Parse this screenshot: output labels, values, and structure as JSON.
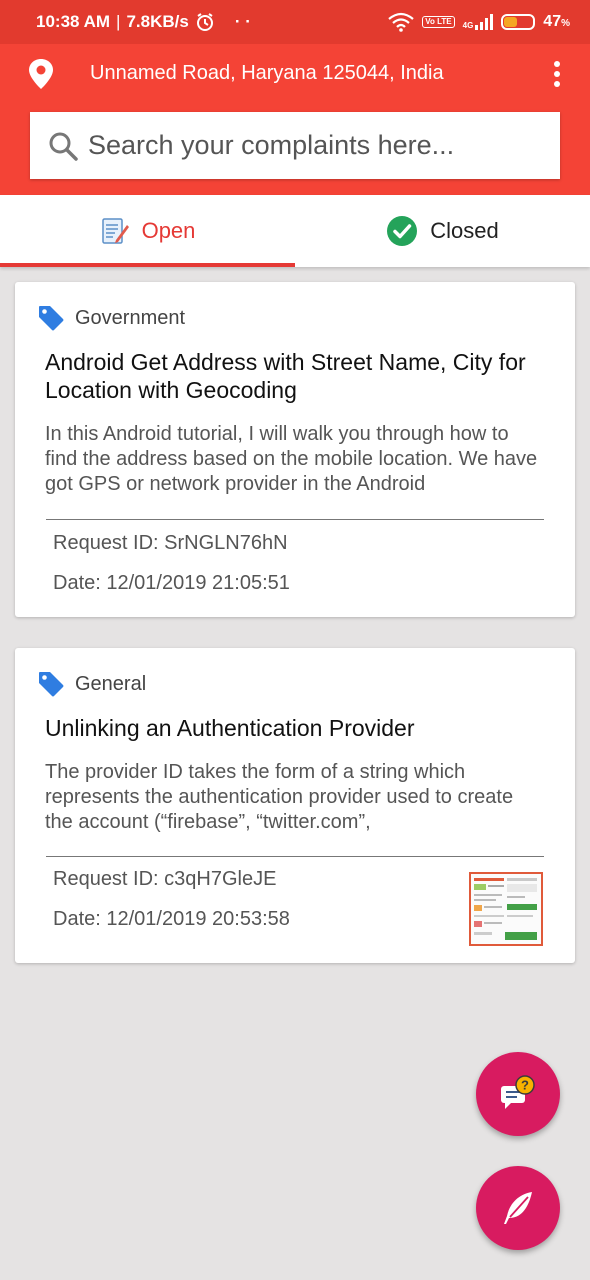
{
  "status_bar": {
    "time": "10:38 AM",
    "separator": "|",
    "speed": "7.8KB/s",
    "dots": "· ·",
    "volte": "Vo LTE",
    "network": "4G",
    "battery_percent": "47",
    "battery_unit": "%",
    "battery_level": 0.47
  },
  "header": {
    "address": "Unnamed Road, Haryana 125044, India",
    "search_placeholder": "Search your complaints here..."
  },
  "tabs": [
    {
      "label": "Open",
      "active": true
    },
    {
      "label": "Closed",
      "active": false
    }
  ],
  "complaints": [
    {
      "category": "Government",
      "title": "Android Get Address with Street Name, City for Location with Geocoding",
      "description": "In this Android tutorial, I will walk you through how to find the address based on the mobile location. We have got GPS or network provider in the Android",
      "request_id": "Request ID: SrNGLN76hN",
      "date": "Date: 12/01/2019 21:05:51"
    },
    {
      "category": "General",
      "title": "Unlinking an Authentication Provider",
      "description": "The provider ID takes the form of a string which represents the authentication provider used to create the account (“firebase”, “twitter.com”,",
      "request_id": "Request ID: c3qH7GleJE",
      "date": "Date: 12/01/2019 20:53:58"
    }
  ],
  "colors": {
    "status_bar": "#e23a2e",
    "header": "#f44336",
    "accent": "#e53935",
    "fab": "#d81b60",
    "tag": "#2f7de1",
    "check": "#24a35a"
  },
  "icons": {
    "location": "location-pin-icon",
    "menu": "overflow-menu-icon",
    "search": "search-icon",
    "open_tab": "document-edit-icon",
    "closed_tab": "check-circle-icon",
    "tag": "tag-icon",
    "help_fab": "chat-question-icon",
    "new_fab": "feather-pen-icon"
  }
}
